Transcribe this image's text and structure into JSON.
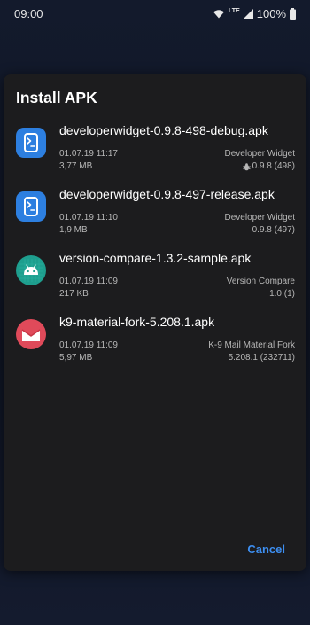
{
  "status_bar": {
    "time": "09:00",
    "network": "LTE",
    "battery": "100%"
  },
  "dialog": {
    "title": "Install APK",
    "cancel_label": "Cancel"
  },
  "apks": [
    {
      "name": "developerwidget-0.9.8-498-debug.apk",
      "date": "01.07.19 11:17",
      "size": "3,77 MB",
      "app": "Developer Widget",
      "version": "0.9.8 (498)",
      "icon": "terminal-icon",
      "debug_badge": true
    },
    {
      "name": "developerwidget-0.9.8-497-release.apk",
      "date": "01.07.19 11:10",
      "size": "1,9 MB",
      "app": "Developer Widget",
      "version": "0.9.8 (497)",
      "icon": "terminal-icon",
      "debug_badge": false
    },
    {
      "name": "version-compare-1.3.2-sample.apk",
      "date": "01.07.19 11:09",
      "size": "217 KB",
      "app": "Version Compare",
      "version": "1.0 (1)",
      "icon": "android-icon",
      "debug_badge": false
    },
    {
      "name": "k9-material-fork-5.208.1.apk",
      "date": "01.07.19 11:09",
      "size": "5,97 MB",
      "app": "K-9 Mail Material Fork",
      "version": "5.208.1 (232711)",
      "icon": "mail-icon",
      "debug_badge": false
    }
  ],
  "colors": {
    "dialog_bg": "#1c1c1e",
    "accent": "#3d8ef0",
    "devwidget_blue": "#2d7fe0",
    "android_teal": "#1e9e8e",
    "k9_red": "#e04a5a"
  }
}
